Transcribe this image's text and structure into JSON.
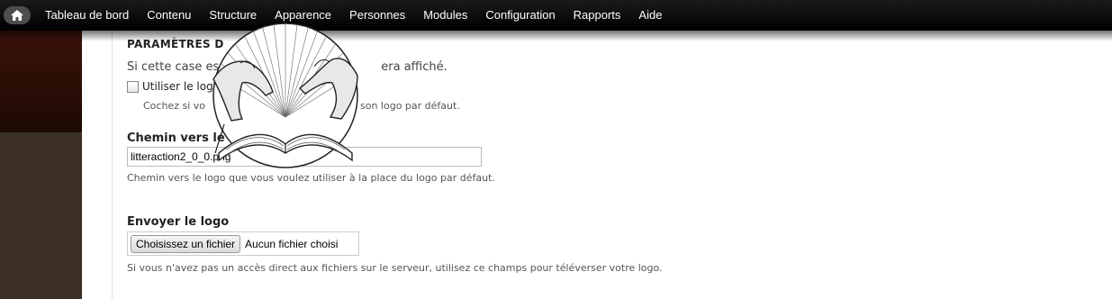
{
  "toolbar": {
    "home_icon": "home-icon",
    "items": [
      {
        "label": "Tableau de bord"
      },
      {
        "label": "Contenu"
      },
      {
        "label": "Structure"
      },
      {
        "label": "Apparence"
      },
      {
        "label": "Personnes"
      },
      {
        "label": "Modules"
      },
      {
        "label": "Configuration"
      },
      {
        "label": "Rapports"
      },
      {
        "label": "Aide"
      }
    ]
  },
  "logo_settings": {
    "legend": "PARAMÈTRES D",
    "description": "Si cette case es",
    "description_end": "era affiché.",
    "checkbox_label": "Utiliser le log",
    "checkbox_checked": false,
    "checkbox_help": "Cochez si vo",
    "checkbox_help_end": "son logo par défaut."
  },
  "logo_path": {
    "label": "Chemin vers le",
    "value": "litteraction2_0_0.png",
    "help": "Chemin vers le logo que vous voulez utiliser à la place du logo par défaut."
  },
  "logo_upload": {
    "label": "Envoyer le logo",
    "button": "Choisissez un fichier",
    "status": "Aucun fichier choisi",
    "help": "Si vous n'avez pas un accès direct aux fichiers sur le serveur, utilisez ce champs pour téléverser votre logo."
  },
  "colors": {
    "toolbar": "#000000",
    "sidebar": "#3b2f26"
  }
}
